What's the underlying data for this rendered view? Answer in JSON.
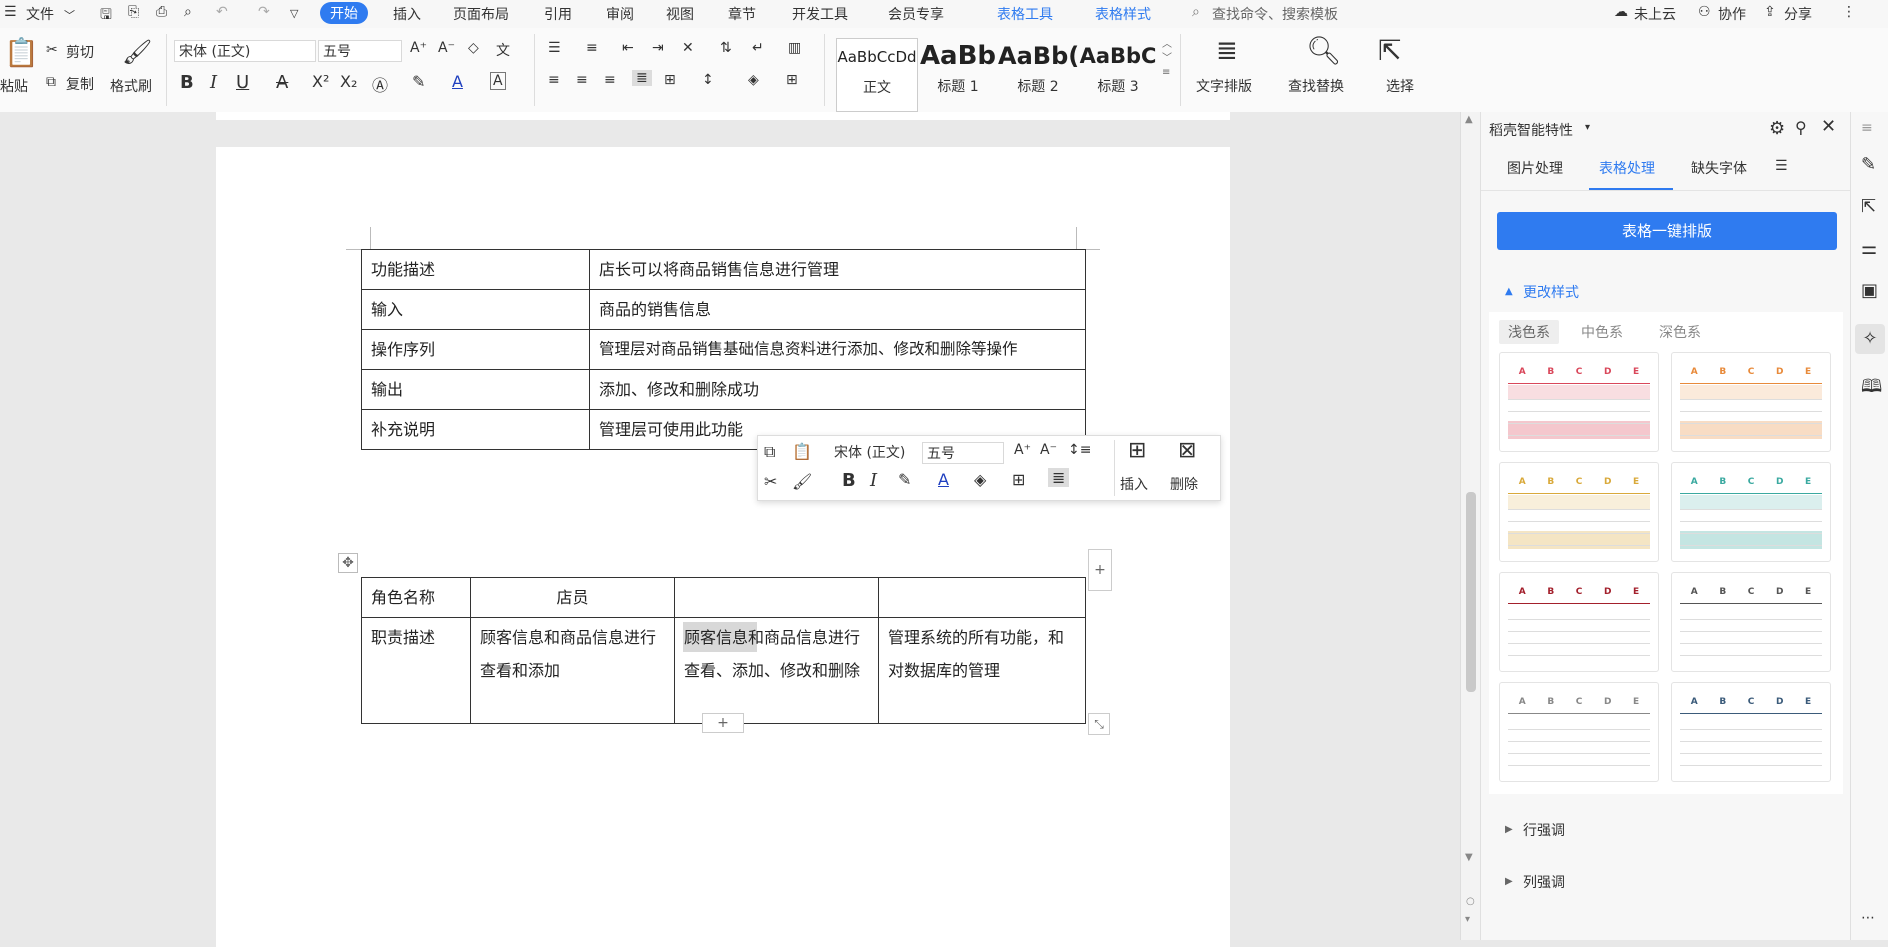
{
  "menubar": {
    "file": "文件",
    "tabs": [
      {
        "label": "开始",
        "active": true
      },
      {
        "label": "插入"
      },
      {
        "label": "页面布局"
      },
      {
        "label": "引用"
      },
      {
        "label": "审阅"
      },
      {
        "label": "视图"
      },
      {
        "label": "章节"
      },
      {
        "label": "开发工具"
      },
      {
        "label": "会员专享"
      },
      {
        "label": "表格工具",
        "contextual": true
      },
      {
        "label": "表格样式",
        "contextual": true
      }
    ],
    "search_placeholder": "查找命令、搜索模板",
    "cloud": "未上云",
    "collab": "协作",
    "share": "分享"
  },
  "ribbon": {
    "paste": "粘贴",
    "cut": "剪切",
    "copy": "复制",
    "format_painter": "格式刷",
    "font_name": "宋体 (正文)",
    "font_size": "五号",
    "styles": [
      {
        "preview": "AaBbCcDd",
        "label": "正文"
      },
      {
        "preview": "AaBb",
        "label": "标题 1"
      },
      {
        "preview": "AaBb(",
        "label": "标题 2"
      },
      {
        "preview": "AaBbC",
        "label": "标题 3"
      }
    ],
    "text_layout": "文字排版",
    "find_replace": "查找替换",
    "select": "选择"
  },
  "document": {
    "table1": [
      [
        "功能描述",
        "店长可以将商品销售信息进行管理"
      ],
      [
        "输入",
        "商品的销售信息"
      ],
      [
        "操作序列",
        "管理层对商品销售基础信息资料进行添加、修改和删除等操作"
      ],
      [
        "输出",
        "添加、修改和删除成功"
      ],
      [
        "补充说明",
        "管理层可使用此功能"
      ]
    ],
    "table2": {
      "header": [
        "角色名称",
        "店员",
        "",
        ""
      ],
      "row": [
        "职责描述",
        "顾客信息和商品信息进行查看和添加",
        "顾客信息和商品信息进行查看、添加、修改和删除",
        "管理系统的所有功能，和对数据库的管理"
      ],
      "selected_text": "顾客信息"
    }
  },
  "float_toolbar": {
    "font_name": "宋体 (正文)",
    "font_size": "五号",
    "insert": "插入",
    "delete": "删除"
  },
  "panel": {
    "title": "稻壳智能特性",
    "tabs": [
      "图片处理",
      "表格处理",
      "缺失字体"
    ],
    "active_tab": "表格处理",
    "primary_button": "表格一键排版",
    "section_change_style": "更改样式",
    "style_tabs": [
      "浅色系",
      "中色系",
      "深色系"
    ],
    "thumb_cols": [
      "A",
      "B",
      "C",
      "D",
      "E"
    ],
    "thumb_colors": [
      "#d9475a",
      "#e88a3a",
      "#d9a93a",
      "#3aa9a0",
      "#a3202c",
      "#555555",
      "#888888",
      "#3b5b7a"
    ],
    "section_row_emphasis": "行强调",
    "section_col_emphasis": "列强调"
  }
}
